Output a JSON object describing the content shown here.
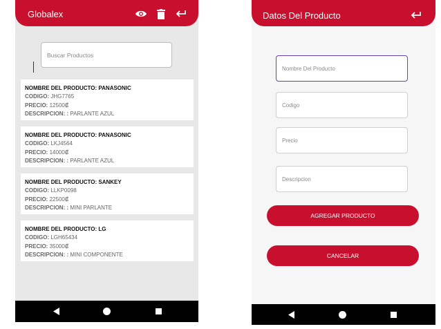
{
  "left_screen": {
    "app_title": "Globalex",
    "actions": {
      "view": "eye-icon",
      "delete": "trash-icon",
      "back": "back-arrow-icon"
    },
    "search": {
      "placeholder": "Buscar Productos",
      "value": ""
    },
    "products": [
      {
        "name_label": "NOMBRE DEL PRODUCTO:",
        "name": "PANASONIC",
        "code_label": "CODIGO:",
        "code": "JHG7765",
        "price_label": "PRECIO:",
        "price": "12500₡",
        "desc_label": "DESCRIPCION: :",
        "desc": "PARLANTE AZUL"
      },
      {
        "name_label": "NOMBRE DEL PRODUCTO:",
        "name": "PANASONIC",
        "code_label": "CODIGO:",
        "code": "LKJ4564",
        "price_label": "PRECIO:",
        "price": "14000₡",
        "desc_label": "DESCRIPCION: :",
        "desc": "PARLANTE AZUL"
      },
      {
        "name_label": "NOMBRE DEL PRODUCTO:",
        "name": "SANKEY",
        "code_label": "CODIGO:",
        "code": "LLKP0098",
        "price_label": "PRECIO:",
        "price": "22500₡",
        "desc_label": "DESCRIPCION: :",
        "desc": "MINI PARLANTE"
      },
      {
        "name_label": "NOMBRE DEL PRODUCTO:",
        "name": "LG",
        "code_label": "CODIGO:",
        "code": "LGH65434",
        "price_label": "PRECIO:",
        "price": "35000₡",
        "desc_label": "DESCRIPCION: :",
        "desc": "MINI COMPONENTE"
      }
    ]
  },
  "right_screen": {
    "title": "Datos Del Producto",
    "back_icon": "back-arrow-icon",
    "fields": {
      "name": {
        "placeholder": "Nombre Del Producto",
        "value": ""
      },
      "code": {
        "placeholder": "Codigo",
        "value": ""
      },
      "price": {
        "placeholder": "Precio",
        "value": ""
      },
      "description": {
        "placeholder": "Descripcion",
        "value": ""
      }
    },
    "buttons": {
      "add": "AGREGAR PRODUCTO",
      "cancel": "CANCELAR"
    }
  },
  "colors": {
    "primary": "#c8102e",
    "focus": "#6a3fb0",
    "nav": "#000000"
  }
}
